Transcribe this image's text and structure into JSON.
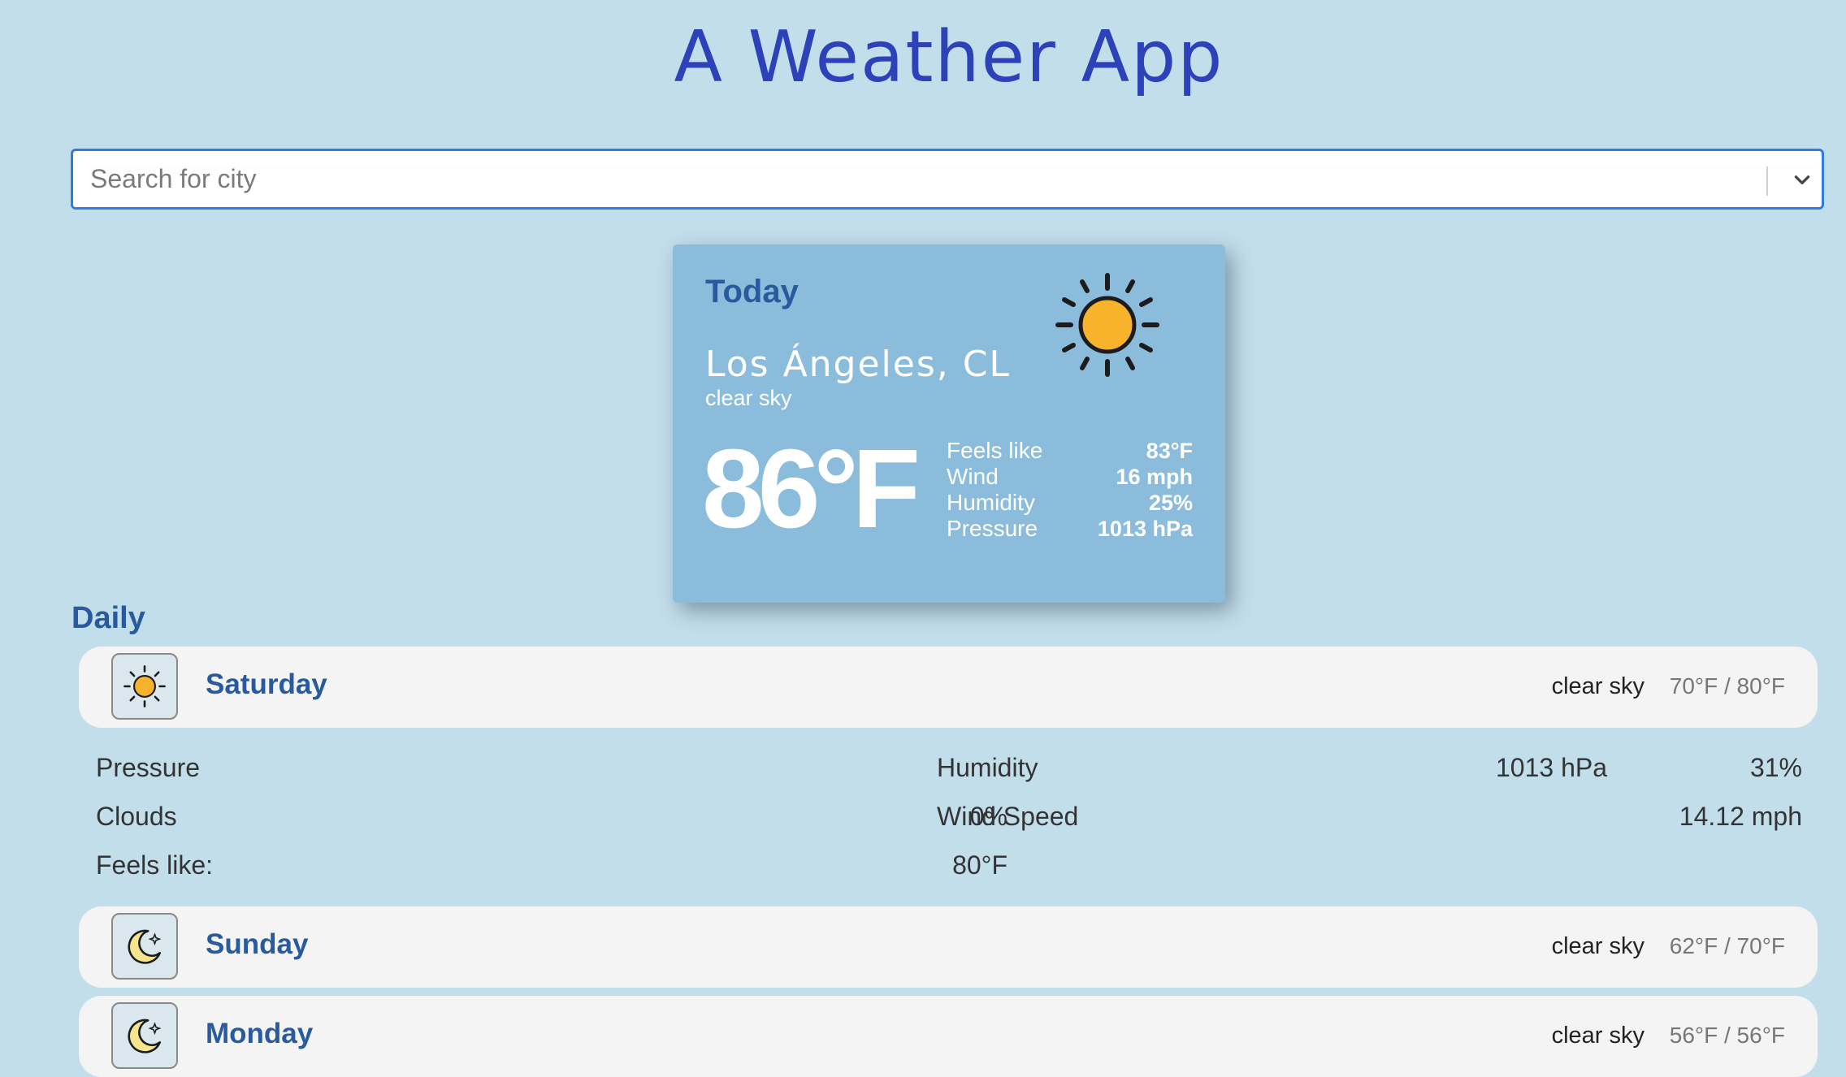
{
  "app": {
    "title": "A Weather App"
  },
  "search": {
    "placeholder": "Search for city"
  },
  "today": {
    "label": "Today",
    "city": "Los Ángeles, CL",
    "description": "clear sky",
    "temperature": "86°F",
    "icon": "sun-icon",
    "details": [
      {
        "label": "Feels like",
        "value": "83°F"
      },
      {
        "label": "Wind",
        "value": "16 mph"
      },
      {
        "label": "Humidity",
        "value": "25%"
      },
      {
        "label": "Pressure",
        "value": "1013 hPa"
      }
    ]
  },
  "daily": {
    "title": "Daily",
    "days": [
      {
        "name": "Saturday",
        "description": "clear sky",
        "temps": "70°F / 80°F",
        "icon": "sun-icon"
      },
      {
        "name": "Sunday",
        "description": "clear sky",
        "temps": "62°F / 70°F",
        "icon": "moon-icon"
      },
      {
        "name": "Monday",
        "description": "clear sky",
        "temps": "56°F / 56°F",
        "icon": "moon-icon"
      }
    ],
    "expanded": {
      "pressure_label": "Pressure",
      "pressure_value": "1013 hPa",
      "humidity_label": "Humidity",
      "humidity_value": "31%",
      "clouds_label": "Clouds",
      "clouds_value": "0%",
      "wind_label": "Wind Speed",
      "wind_value": "14.12 mph",
      "feels_label": "Feels like:",
      "feels_value": "80°F"
    }
  },
  "colors": {
    "background": "#c3deeb",
    "title": "#2d41b8",
    "card": "#8bbcdb",
    "accent": "#2a5a9e",
    "search_border": "#2f7de1",
    "sun": "#f7b32b"
  }
}
